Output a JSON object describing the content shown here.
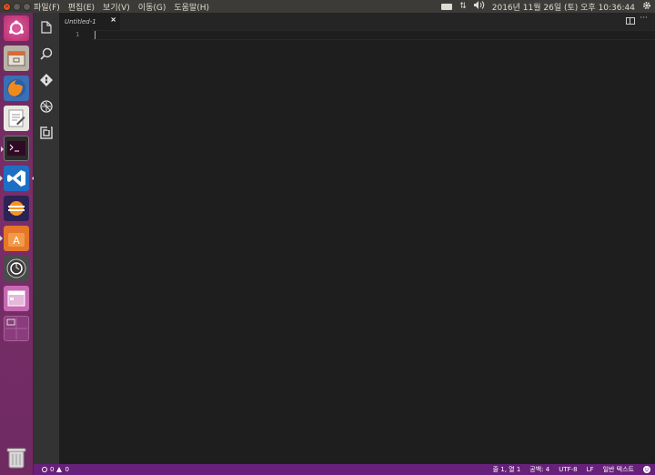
{
  "top_panel": {
    "menus": [
      "파일(F)",
      "편집(E)",
      "보기(V)",
      "이동(G)",
      "도움말(H)"
    ],
    "datetime": "2016년 11월 26일 (토) 오후 10:36:44",
    "icons": [
      "keyboard-icon",
      "network-icon",
      "volume-icon",
      "settings-icon"
    ]
  },
  "launcher": {
    "items": [
      "dash-icon",
      "files-icon",
      "firefox-icon",
      "text-editor-icon",
      "terminal-icon",
      "vscode-icon",
      "eclipse-icon",
      "software-center-icon",
      "software-updater-icon",
      "window-app-icon",
      "workspace-switcher-icon",
      "trash-icon"
    ]
  },
  "activity_bar": {
    "icons": [
      "explorer-icon",
      "search-icon",
      "git-icon",
      "debug-icon",
      "extensions-icon"
    ]
  },
  "editor": {
    "tab_label": "Untitled-1",
    "tab_close": "×",
    "line_number": "1"
  },
  "status_bar": {
    "errors": "0",
    "warnings": "0",
    "position": "줄 1, 열 1",
    "spaces": "공백: 4",
    "encoding": "UTF-8",
    "eol": "LF",
    "language": "일반 텍스트"
  },
  "colors": {
    "status_bar": "#68217a",
    "editor_bg": "#1e1e1e",
    "activity_bar": "#333333",
    "launcher": "#7a2e69"
  }
}
